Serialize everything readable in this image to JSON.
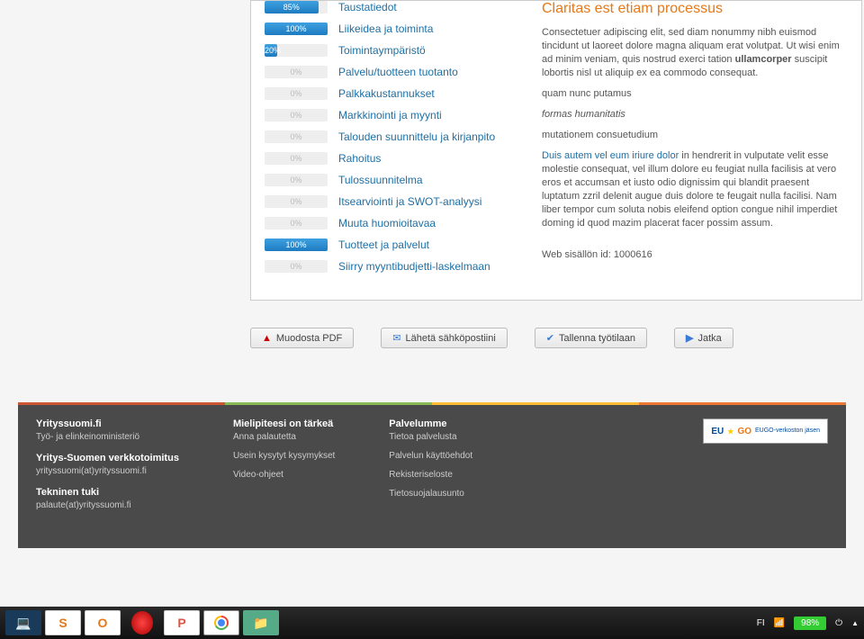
{
  "list": [
    {
      "pct": 85,
      "label": "Taustatiedot"
    },
    {
      "pct": 100,
      "label": "Liikeidea ja toiminta"
    },
    {
      "pct": 20,
      "label": "Toimintaympäristö"
    },
    {
      "pct": 0,
      "label": "Palvelu/tuotteen tuotanto"
    },
    {
      "pct": 0,
      "label": "Palkkakustannukset"
    },
    {
      "pct": 0,
      "label": "Markkinointi ja myynti"
    },
    {
      "pct": 0,
      "label": "Talouden suunnittelu ja kirjanpito"
    },
    {
      "pct": 0,
      "label": "Rahoitus"
    },
    {
      "pct": 0,
      "label": "Tulossuunnitelma"
    },
    {
      "pct": 0,
      "label": "Itsearviointi ja SWOT-analyysi"
    },
    {
      "pct": 0,
      "label": "Muuta huomioitavaa"
    },
    {
      "pct": 100,
      "label": "Tuotteet ja palvelut"
    },
    {
      "pct": 0,
      "label": "Siirry myyntibudjetti-laskelmaan"
    }
  ],
  "article": {
    "title": "Claritas est etiam processus",
    "p1a": "Consectetuer adipiscing elit, sed diam nonummy nibh euismod tincidunt ut laoreet dolore magna aliquam erat volutpat. Ut wisi enim ad minim veniam, quis nostrud exerci tation ",
    "p1b": "ullamcorper",
    "p1c": " suscipit lobortis nisl ut aliquip ex ea commodo consequat.",
    "l1": "quam nunc putamus",
    "l2": "formas humanitatis",
    "l3": "mutationem consuetudium",
    "p2a": "Duis autem vel eum iriure dolor",
    "p2b": " in hendrerit in vulputate velit esse molestie consequat, vel illum dolore eu feugiat nulla facilisis at vero eros et accumsan et iusto odio dignissim qui blandit praesent luptatum zzril delenit augue duis dolore te feugait nulla facilisi. Nam liber tempor cum soluta nobis eleifend option congue nihil imperdiet doming id quod mazim placerat facer possim assum.",
    "idline": "Web sisällön id: 1000616"
  },
  "buttons": {
    "pdf": "Muodosta PDF",
    "email": "Lähetä sähköpostiini",
    "save": "Tallenna työtilaan",
    "cont": "Jatka"
  },
  "footer": {
    "col1": {
      "h1": "Yrityssuomi.fi",
      "s1": "Työ- ja elinkeinoministeriö",
      "h2": "Yritys-Suomen verkkotoimitus",
      "s2": "yrityssuomi(at)yrityssuomi.fi",
      "h3": "Tekninen tuki",
      "s3": "palaute(at)yrityssuomi.fi"
    },
    "col2": {
      "h": "Mielipiteesi on tärkeä",
      "a1": "Anna palautetta",
      "a2": "Usein kysytyt kysymykset",
      "a3": "Video-ohjeet"
    },
    "col3": {
      "h": "Palvelumme",
      "a1": "Tietoa palvelusta",
      "a2": "Palvelun käyttöehdot",
      "a3": "Rekisteriseloste",
      "a4": "Tietosuojalausunto"
    },
    "eugo": {
      "brand": "EUGO",
      "txt": "EUGO-verkoston jäsen"
    }
  },
  "taskbar": {
    "lang": "FI",
    "battery": "98%"
  }
}
